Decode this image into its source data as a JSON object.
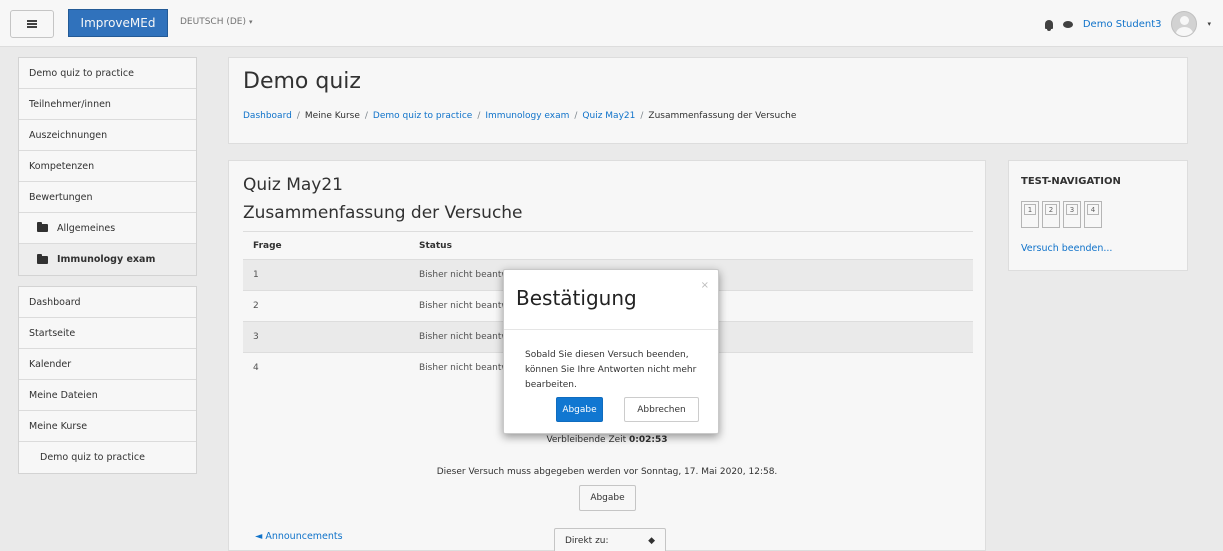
{
  "navbar": {
    "brand": "ImproveMEd",
    "language": "DEUTSCH (DE)",
    "language_caret": "▾",
    "user_name": "Demo Student3",
    "user_caret": "▾"
  },
  "sidebar": {
    "course_group": [
      {
        "label": "Demo quiz to practice"
      },
      {
        "label": "Teilnehmer/innen"
      },
      {
        "label": "Auszeichnungen"
      },
      {
        "label": "Kompetenzen"
      },
      {
        "label": "Bewertungen"
      },
      {
        "label": "Allgemeines",
        "icon": "folder-icon"
      },
      {
        "label": "Immunology exam",
        "icon": "folder-icon",
        "active": true
      }
    ],
    "site_group": [
      {
        "label": "Dashboard"
      },
      {
        "label": "Startseite"
      },
      {
        "label": "Kalender"
      },
      {
        "label": "Meine Dateien"
      },
      {
        "label": "Meine Kurse"
      },
      {
        "label": "Demo quiz to practice"
      }
    ]
  },
  "header": {
    "title": "Demo quiz",
    "breadcrumb": [
      "Dashboard",
      "Meine Kurse",
      "Demo quiz to practice",
      "Immunology exam",
      "Quiz May21",
      "Zusammenfassung der Versuche"
    ],
    "separator": "/"
  },
  "main": {
    "quiz_title": "Quiz May21",
    "summary_title": "Zusammenfassung der Versuche",
    "table": {
      "headers": [
        "Frage",
        "Status"
      ],
      "rows": [
        {
          "question": "1",
          "status": "Bisher nicht beantwortet"
        },
        {
          "question": "2",
          "status": "Bisher nicht beantwortet"
        },
        {
          "question": "3",
          "status": "Bisher nicht beantwortet"
        },
        {
          "question": "4",
          "status": "Bisher nicht beantwortet"
        }
      ]
    },
    "time_left_label": "Verbleibende Zeit ",
    "time_left_value": "0:02:53",
    "deadline": "Dieser Versuch muss abgegeben werden vor Sonntag, 17. Mai 2020, 12:58.",
    "submit_label": "Abgabe",
    "prev_link": "◄ Announcements",
    "jump_label": "Direkt zu:",
    "jump_arrow": "◆"
  },
  "quiz_nav": {
    "title": "TEST-NAVIGATION",
    "questions": [
      "1",
      "2",
      "3",
      "4"
    ],
    "finish_link": "Versuch beenden..."
  },
  "modal": {
    "title": "Bestätigung",
    "close": "×",
    "body": "Sobald Sie diesen Versuch beenden, können Sie Ihre Antworten nicht mehr bearbeiten.",
    "confirm_label": "Abgabe",
    "cancel_label": "Abbrechen"
  },
  "colors": {
    "brand": "#3276c3",
    "link": "#1177d1",
    "primary_button": "#1177d1"
  }
}
